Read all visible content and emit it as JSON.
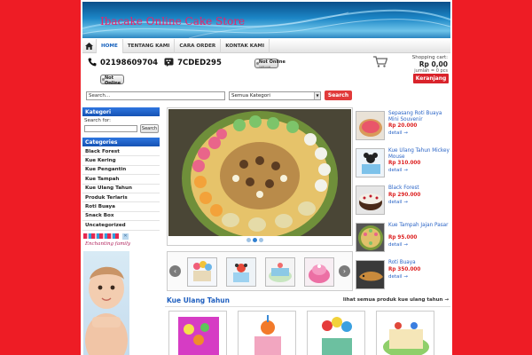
{
  "header": {
    "store_title": "Ibacake Online Cake Store"
  },
  "nav": {
    "home_icon": "home-icon",
    "items": [
      {
        "label": "HOME",
        "active": true
      },
      {
        "label": "TENTANG KAMI",
        "active": false
      },
      {
        "label": "CARA ORDER",
        "active": false
      },
      {
        "label": "KONTAK KAMI",
        "active": false
      }
    ]
  },
  "contact": {
    "phone": "02198609704",
    "pin": "7CDED295",
    "status_line1": "Not Online",
    "status_line2": "right now",
    "status2_line1": "Not Online",
    "status2_line2": "right now"
  },
  "cart": {
    "label": "Shopping cart:",
    "amount": "Rp 0,00",
    "quantity": "jumlah = 0 pcs",
    "button": "Keranjang"
  },
  "search": {
    "placeholder": "Search...",
    "category": "Semua Kategori",
    "button": "Search"
  },
  "sidebar": {
    "kategori_title": "Kategori",
    "search_for": "Search for:",
    "search_button": "Search",
    "categories_title": "Categories",
    "categories": [
      "Black Forest",
      "Kue Kering",
      "Kue Pengantin",
      "Kue Tampah",
      "Kue Ulang Tahun",
      "Produk Terlaris",
      "Roti Buaya",
      "Snack Box",
      "Uncategorized"
    ],
    "ad_brand": "Enchanting family"
  },
  "products": [
    {
      "name": "Sepasang Roti Buaya Mini Souvenir",
      "price": "Rp 20.000",
      "detail": "detail →"
    },
    {
      "name": "Kue Ulang Tahun Mickey Mouse",
      "price": "Rp 310.000",
      "detail": "detail →"
    },
    {
      "name": "Black Forest",
      "price": "Rp 290.000",
      "detail": "detail →"
    },
    {
      "name": "Kue Tampah Jajan Pasar",
      "price": "Rp 95.000",
      "detail": "detail →"
    },
    {
      "name": "Roti Buaya",
      "price": "Rp 350.000",
      "detail": "detail →"
    }
  ],
  "section": {
    "title": "Kue Ulang Tahun",
    "link": "lihat semua produk kue ulang tahun →"
  },
  "slider": {
    "active_dot": 2,
    "dot_count": 3
  },
  "colors": {
    "background": "#ee1c25",
    "accent_blue": "#1560bd",
    "price_red": "#dd2222",
    "button_red": "#d9232b"
  }
}
